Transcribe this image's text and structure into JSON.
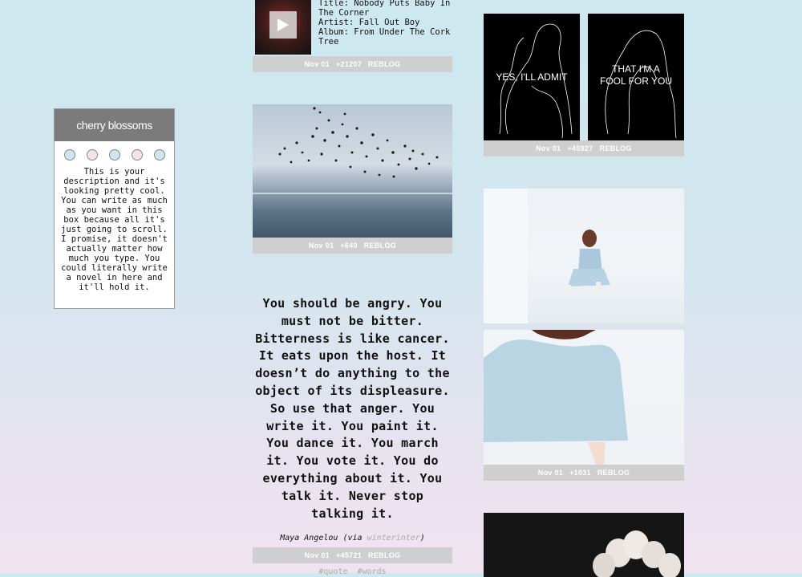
{
  "sidebar": {
    "title": "cherry blossoms",
    "dot_colors": [
      "#cfe6ef",
      "#f5e2ec",
      "#cfe6ef",
      "#f5e2ec",
      "#cfe6ef"
    ],
    "description": "This is your description and it's looking pretty cool. You can write as much as you want in this box because all it's just going to scroll. I promise, it doesn't actually matter how much you type. You could literally write a novel in here and it'll hold it."
  },
  "posts": {
    "audio": {
      "title_line": "Title: Nobody Puts Baby In The Corner",
      "artist_line": "Artist: Fall Out Boy",
      "album_line": "Album: From Under The Cork Tree",
      "date": "Nov 01",
      "notes": "+21207",
      "reblog": "REBLOG",
      "play_icon": "play-icon"
    },
    "birds": {
      "date": "Nov 01",
      "notes": "+640",
      "reblog": "REBLOG"
    },
    "quote": {
      "text": "You should be angry. You must not be bitter. Bitterness is like cancer. It eats upon the host. It doesn’t do anything to the object of its displeasure. So use that anger. You write it. You paint it. You dance it. You march it. You vote it. You do everything about it. You talk it. Never stop talking it.",
      "author": "Maya Angelou",
      "via_prefix": "(via ",
      "via_user": "winterinter",
      "via_suffix": ")",
      "date": "Nov 01",
      "notes": "+45721",
      "reblog": "REBLOG",
      "tags": [
        "#quote",
        "#words"
      ]
    },
    "sketches": {
      "left_caption": "YES, I'LL ADMIT",
      "right_caption_1": "THAT I'M A",
      "right_caption_2": "FOOL FOR YOU",
      "date": "Nov 01",
      "notes": "+45927",
      "reblog": "REBLOG"
    },
    "girl": {
      "date": "Nov 01",
      "notes": "+1031",
      "reblog": "REBLOG"
    }
  }
}
